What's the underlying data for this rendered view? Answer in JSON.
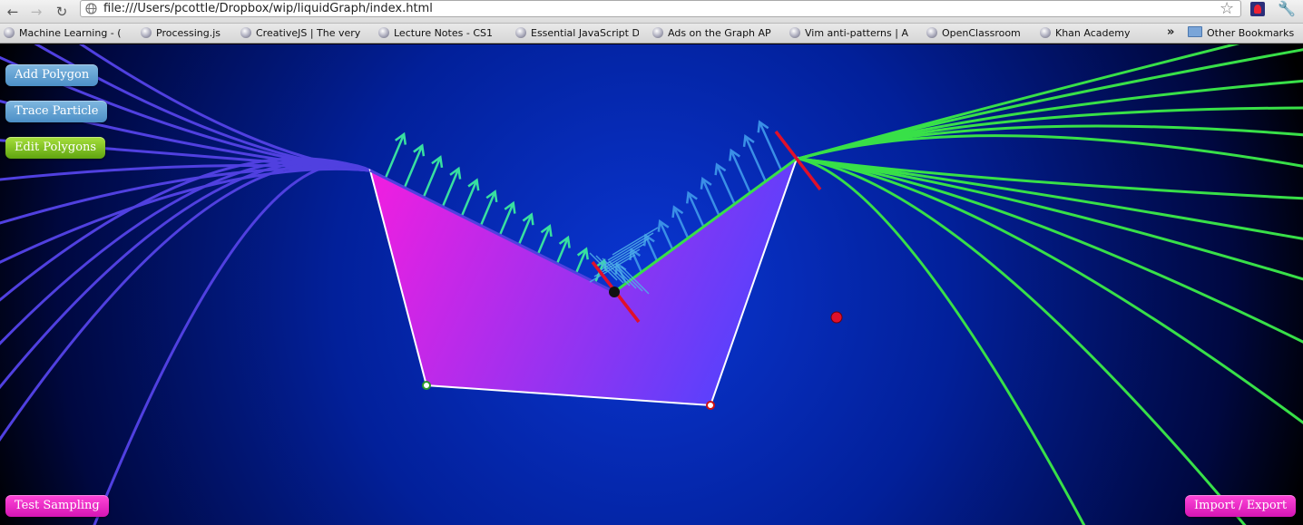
{
  "browser": {
    "url": "file:///Users/pcottle/Dropbox/wip/liquidGraph/index.html",
    "back_icon": "back-arrow-icon",
    "forward_icon": "forward-arrow-icon",
    "reload_icon": "reload-icon",
    "bookmarks": [
      {
        "label": "Machine Learning - ("
      },
      {
        "label": "Processing.js"
      },
      {
        "label": "CreativeJS | The very"
      },
      {
        "label": "Lecture Notes - CS1"
      },
      {
        "label": "Essential JavaScript D"
      },
      {
        "label": "Ads on the Graph AP"
      },
      {
        "label": "Vim anti-patterns | A"
      },
      {
        "label": "OpenClassroom"
      },
      {
        "label": "Khan Academy"
      }
    ],
    "overflow_label": "»",
    "other_bookmarks": "Other Bookmarks"
  },
  "app": {
    "buttons": {
      "add_polygon": "Add Polygon",
      "trace_particle": "Trace Particle",
      "edit_polygons": "Edit Polygons",
      "test_sampling": "Test Sampling",
      "import_export": "Import / Export"
    },
    "colors": {
      "background_center": "#0a36d2",
      "left_flow_lines": "#5040e0",
      "right_flow_lines": "#38e048",
      "normal_arrows": "#38e0a0",
      "normal_arrows_right": "#3a8fe6",
      "polygon_fill_start": "#f01ee0",
      "polygon_fill_end": "#4a44ff",
      "red_markers": "#e0102a"
    }
  }
}
